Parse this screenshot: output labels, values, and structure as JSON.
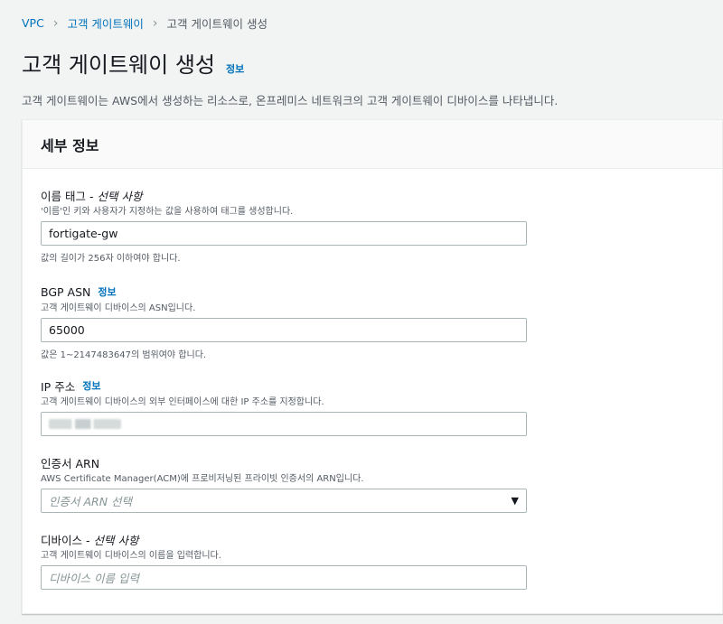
{
  "breadcrumb": {
    "root": "VPC",
    "parent": "고객 게이트웨이",
    "current": "고객 게이트웨이 생성"
  },
  "page": {
    "title": "고객 게이트웨이 생성",
    "info": "정보",
    "description": "고객 게이트웨이는 AWS에서 생성하는 리소스로, 온프레미스 네트워크의 고객 게이트웨이 디바이스를 나타냅니다."
  },
  "panel": {
    "title": "세부 정보"
  },
  "fields": {
    "name_tag": {
      "label": "이름 태그 -",
      "optional": "선택 사항",
      "description": "'이름'인 키와 사용자가 지정하는 값을 사용하여 태그를 생성합니다.",
      "value": "fortigate-gw",
      "hint": "값의 길이가 256자 이하여야 합니다."
    },
    "bgp_asn": {
      "label": "BGP ASN",
      "info": "정보",
      "description": "고객 게이트웨이 디바이스의 ASN입니다.",
      "value": "65000",
      "hint": "값은 1~2147483647의 범위여야 합니다."
    },
    "ip_address": {
      "label": "IP 주소",
      "info": "정보",
      "description": "고객 게이트웨이 디바이스의 외부 인터페이스에 대한 IP 주소를 지정합니다."
    },
    "cert_arn": {
      "label": "인증서 ARN",
      "description": "AWS Certificate Manager(ACM)에 프로비저닝된 프라이빗 인증서의 ARN입니다.",
      "placeholder": "인증서 ARN 선택",
      "icon": "caret-down-icon"
    },
    "device": {
      "label": "디바이스 -",
      "optional": "선택 사항",
      "description": "고객 게이트웨이 디바이스의 이름을 입력합니다.",
      "placeholder": "디바이스 이름 입력"
    }
  },
  "colors": {
    "link": "#0073bb",
    "background": "#f2f3f3",
    "border": "#aab7b8"
  }
}
